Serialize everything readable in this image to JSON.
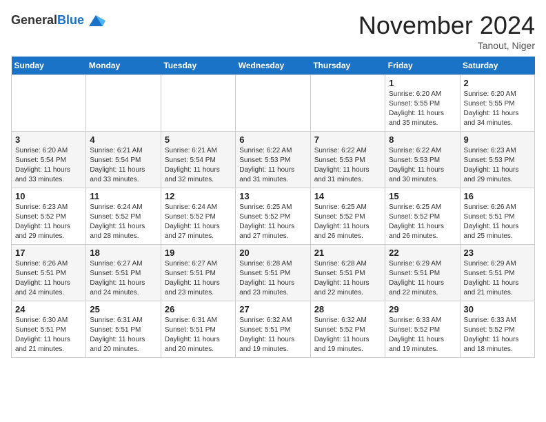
{
  "header": {
    "logo_line1": "General",
    "logo_line2": "Blue",
    "month": "November 2024",
    "location": "Tanout, Niger"
  },
  "weekdays": [
    "Sunday",
    "Monday",
    "Tuesday",
    "Wednesday",
    "Thursday",
    "Friday",
    "Saturday"
  ],
  "weeks": [
    [
      {
        "day": "",
        "info": ""
      },
      {
        "day": "",
        "info": ""
      },
      {
        "day": "",
        "info": ""
      },
      {
        "day": "",
        "info": ""
      },
      {
        "day": "",
        "info": ""
      },
      {
        "day": "1",
        "info": "Sunrise: 6:20 AM\nSunset: 5:55 PM\nDaylight: 11 hours\nand 35 minutes."
      },
      {
        "day": "2",
        "info": "Sunrise: 6:20 AM\nSunset: 5:55 PM\nDaylight: 11 hours\nand 34 minutes."
      }
    ],
    [
      {
        "day": "3",
        "info": "Sunrise: 6:20 AM\nSunset: 5:54 PM\nDaylight: 11 hours\nand 33 minutes."
      },
      {
        "day": "4",
        "info": "Sunrise: 6:21 AM\nSunset: 5:54 PM\nDaylight: 11 hours\nand 33 minutes."
      },
      {
        "day": "5",
        "info": "Sunrise: 6:21 AM\nSunset: 5:54 PM\nDaylight: 11 hours\nand 32 minutes."
      },
      {
        "day": "6",
        "info": "Sunrise: 6:22 AM\nSunset: 5:53 PM\nDaylight: 11 hours\nand 31 minutes."
      },
      {
        "day": "7",
        "info": "Sunrise: 6:22 AM\nSunset: 5:53 PM\nDaylight: 11 hours\nand 31 minutes."
      },
      {
        "day": "8",
        "info": "Sunrise: 6:22 AM\nSunset: 5:53 PM\nDaylight: 11 hours\nand 30 minutes."
      },
      {
        "day": "9",
        "info": "Sunrise: 6:23 AM\nSunset: 5:53 PM\nDaylight: 11 hours\nand 29 minutes."
      }
    ],
    [
      {
        "day": "10",
        "info": "Sunrise: 6:23 AM\nSunset: 5:52 PM\nDaylight: 11 hours\nand 29 minutes."
      },
      {
        "day": "11",
        "info": "Sunrise: 6:24 AM\nSunset: 5:52 PM\nDaylight: 11 hours\nand 28 minutes."
      },
      {
        "day": "12",
        "info": "Sunrise: 6:24 AM\nSunset: 5:52 PM\nDaylight: 11 hours\nand 27 minutes."
      },
      {
        "day": "13",
        "info": "Sunrise: 6:25 AM\nSunset: 5:52 PM\nDaylight: 11 hours\nand 27 minutes."
      },
      {
        "day": "14",
        "info": "Sunrise: 6:25 AM\nSunset: 5:52 PM\nDaylight: 11 hours\nand 26 minutes."
      },
      {
        "day": "15",
        "info": "Sunrise: 6:25 AM\nSunset: 5:52 PM\nDaylight: 11 hours\nand 26 minutes."
      },
      {
        "day": "16",
        "info": "Sunrise: 6:26 AM\nSunset: 5:51 PM\nDaylight: 11 hours\nand 25 minutes."
      }
    ],
    [
      {
        "day": "17",
        "info": "Sunrise: 6:26 AM\nSunset: 5:51 PM\nDaylight: 11 hours\nand 24 minutes."
      },
      {
        "day": "18",
        "info": "Sunrise: 6:27 AM\nSunset: 5:51 PM\nDaylight: 11 hours\nand 24 minutes."
      },
      {
        "day": "19",
        "info": "Sunrise: 6:27 AM\nSunset: 5:51 PM\nDaylight: 11 hours\nand 23 minutes."
      },
      {
        "day": "20",
        "info": "Sunrise: 6:28 AM\nSunset: 5:51 PM\nDaylight: 11 hours\nand 23 minutes."
      },
      {
        "day": "21",
        "info": "Sunrise: 6:28 AM\nSunset: 5:51 PM\nDaylight: 11 hours\nand 22 minutes."
      },
      {
        "day": "22",
        "info": "Sunrise: 6:29 AM\nSunset: 5:51 PM\nDaylight: 11 hours\nand 22 minutes."
      },
      {
        "day": "23",
        "info": "Sunrise: 6:29 AM\nSunset: 5:51 PM\nDaylight: 11 hours\nand 21 minutes."
      }
    ],
    [
      {
        "day": "24",
        "info": "Sunrise: 6:30 AM\nSunset: 5:51 PM\nDaylight: 11 hours\nand 21 minutes."
      },
      {
        "day": "25",
        "info": "Sunrise: 6:31 AM\nSunset: 5:51 PM\nDaylight: 11 hours\nand 20 minutes."
      },
      {
        "day": "26",
        "info": "Sunrise: 6:31 AM\nSunset: 5:51 PM\nDaylight: 11 hours\nand 20 minutes."
      },
      {
        "day": "27",
        "info": "Sunrise: 6:32 AM\nSunset: 5:51 PM\nDaylight: 11 hours\nand 19 minutes."
      },
      {
        "day": "28",
        "info": "Sunrise: 6:32 AM\nSunset: 5:52 PM\nDaylight: 11 hours\nand 19 minutes."
      },
      {
        "day": "29",
        "info": "Sunrise: 6:33 AM\nSunset: 5:52 PM\nDaylight: 11 hours\nand 19 minutes."
      },
      {
        "day": "30",
        "info": "Sunrise: 6:33 AM\nSunset: 5:52 PM\nDaylight: 11 hours\nand 18 minutes."
      }
    ]
  ]
}
